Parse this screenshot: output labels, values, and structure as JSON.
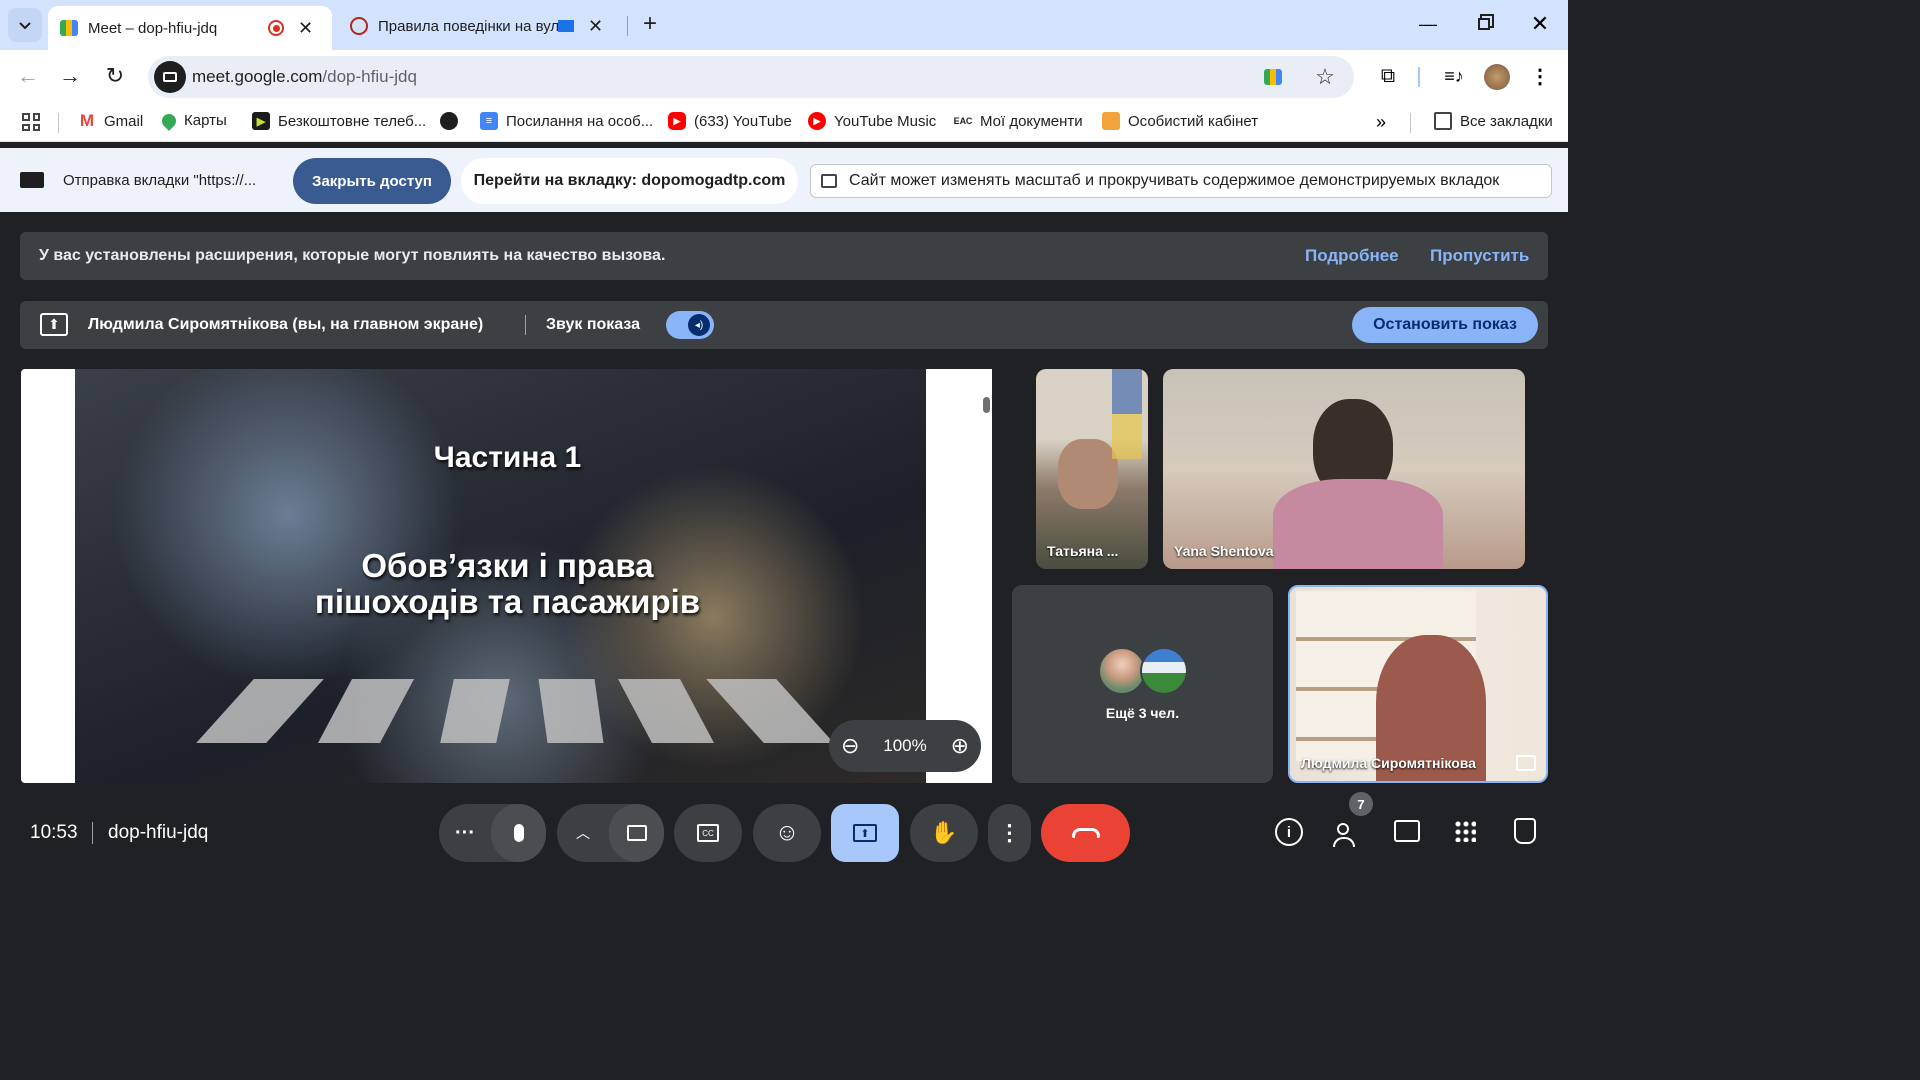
{
  "browser": {
    "tabs": [
      {
        "title": "Meet – dop-hfiu-jdq"
      },
      {
        "title": "Правила поведінки на вул"
      }
    ],
    "url_host": "meet.google.com",
    "url_path": "/dop-hfiu-jdq",
    "bookmarks": [
      {
        "label": "Gmail",
        "icon": "gmail-icon"
      },
      {
        "label": "Карты",
        "icon": "maps-icon"
      },
      {
        "label": "Безкоштовне телеб...",
        "icon": "tv-icon"
      },
      {
        "label": "",
        "icon": "globe-icon"
      },
      {
        "label": "Посилання на особ...",
        "icon": "docs-icon"
      },
      {
        "label": "(633) YouTube",
        "icon": "youtube-icon"
      },
      {
        "label": "YouTube Music",
        "icon": "youtube-music-icon"
      },
      {
        "label": "Мої документи",
        "icon": "eac-icon"
      },
      {
        "label": "Особистий кабінет",
        "icon": "cabinet-icon"
      }
    ],
    "all_bookmarks": "Все закладки"
  },
  "share_bar": {
    "sending_text": "Отправка вкладки \"https://...",
    "stop_access": "Закрыть доступ",
    "goto_tab": "Перейти на вкладку: dopomogadtp.com",
    "notice": "Сайт может изменять масштаб и прокручивать содержимое демонстрируемых вкладок"
  },
  "meet": {
    "banner": {
      "text": "У вас установлены расширения, которые могут повлиять на качество вызова.",
      "more": "Подробнее",
      "skip": "Пропустить"
    },
    "presenting": {
      "presenter": "Людмила Сиромятнікова (вы, на главном экране)",
      "audio_label": "Звук показа",
      "audio_on": true,
      "stop": "Остановить показ"
    },
    "slide": {
      "part": "Частина 1",
      "title_line1": "Обов’язки і права",
      "title_line2": "пішоходів та пасажирів",
      "zoom": "100%"
    },
    "tiles": [
      {
        "name": "Татьяна ..."
      },
      {
        "name": "Yana Shentova"
      },
      {
        "name": "Ещё 3 чел."
      },
      {
        "name": "Людмила Сиромятнікова"
      }
    ],
    "bottom": {
      "time": "10:53",
      "meeting_code": "dop-hfiu-jdq",
      "participants_count": "7"
    },
    "colors": {
      "accent": "#8ab4f8",
      "end_call": "#ea4335",
      "banner_bg": "#3c4043"
    }
  }
}
